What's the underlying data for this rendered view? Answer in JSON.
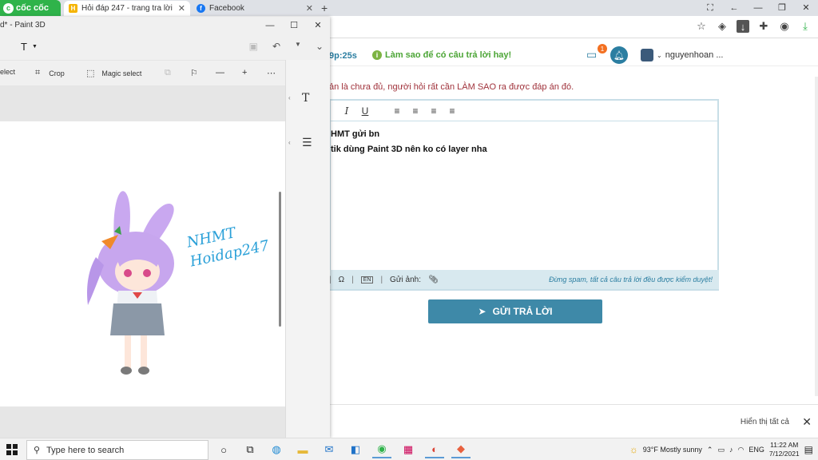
{
  "browser": {
    "brand": "cốc cốc",
    "tabs": [
      {
        "label": "Hỏi đáp 247 - trang tra lời",
        "favicon": "H",
        "active": true
      },
      {
        "label": "Facebook",
        "favicon": "f",
        "active": false
      }
    ],
    "new_tab": "+",
    "window_controls": [
      "⛶",
      "←",
      "—",
      "❐",
      "✕"
    ],
    "toolbar_icons": [
      "star-icon",
      "shield-icon",
      "download-arrow-icon",
      "puzzle-icon",
      "account-icon",
      "download-icon"
    ]
  },
  "page": {
    "timer": "9p:25s",
    "tip": "Làm sao để có câu trả lời hay!",
    "chat_badge": "1",
    "username": "nguyenhoan ...",
    "notice": "ản là chưa đủ, người hỏi rất cần LÀM SAO ra được đáp án đó.",
    "editor": {
      "toolbar": [
        "I",
        "U",
        "≡",
        "≡",
        "≡",
        "≡"
      ],
      "lines": [
        "HMT gửi bn",
        "tik dùng Paint 3D nên ko có layer nha"
      ],
      "footer_kb": "EN",
      "footer_image": "Gửi ảnh:",
      "footer_spam": "Đừng spam, tất cả câu trả lời đều được kiểm duyệt!"
    },
    "submit": "GỬI TRẢ LỜI",
    "show_all": "Hiển thị tất cả"
  },
  "paint": {
    "title": "d* - Paint 3D",
    "text_tool": "T",
    "tools": {
      "select": "elect",
      "crop": "Crop",
      "magic": "Magic select"
    },
    "watermark": [
      "NHMT",
      "Hoidap247"
    ]
  },
  "taskbar": {
    "search_placeholder": "Type here to search",
    "weather": "93°F  Mostly sunny",
    "lang": "ENG",
    "time": "11:22 AM",
    "date": "7/12/2021"
  },
  "colors": {
    "accent": "#3e89a8",
    "brand": "#2fb34a",
    "warn": "#a0323b"
  }
}
